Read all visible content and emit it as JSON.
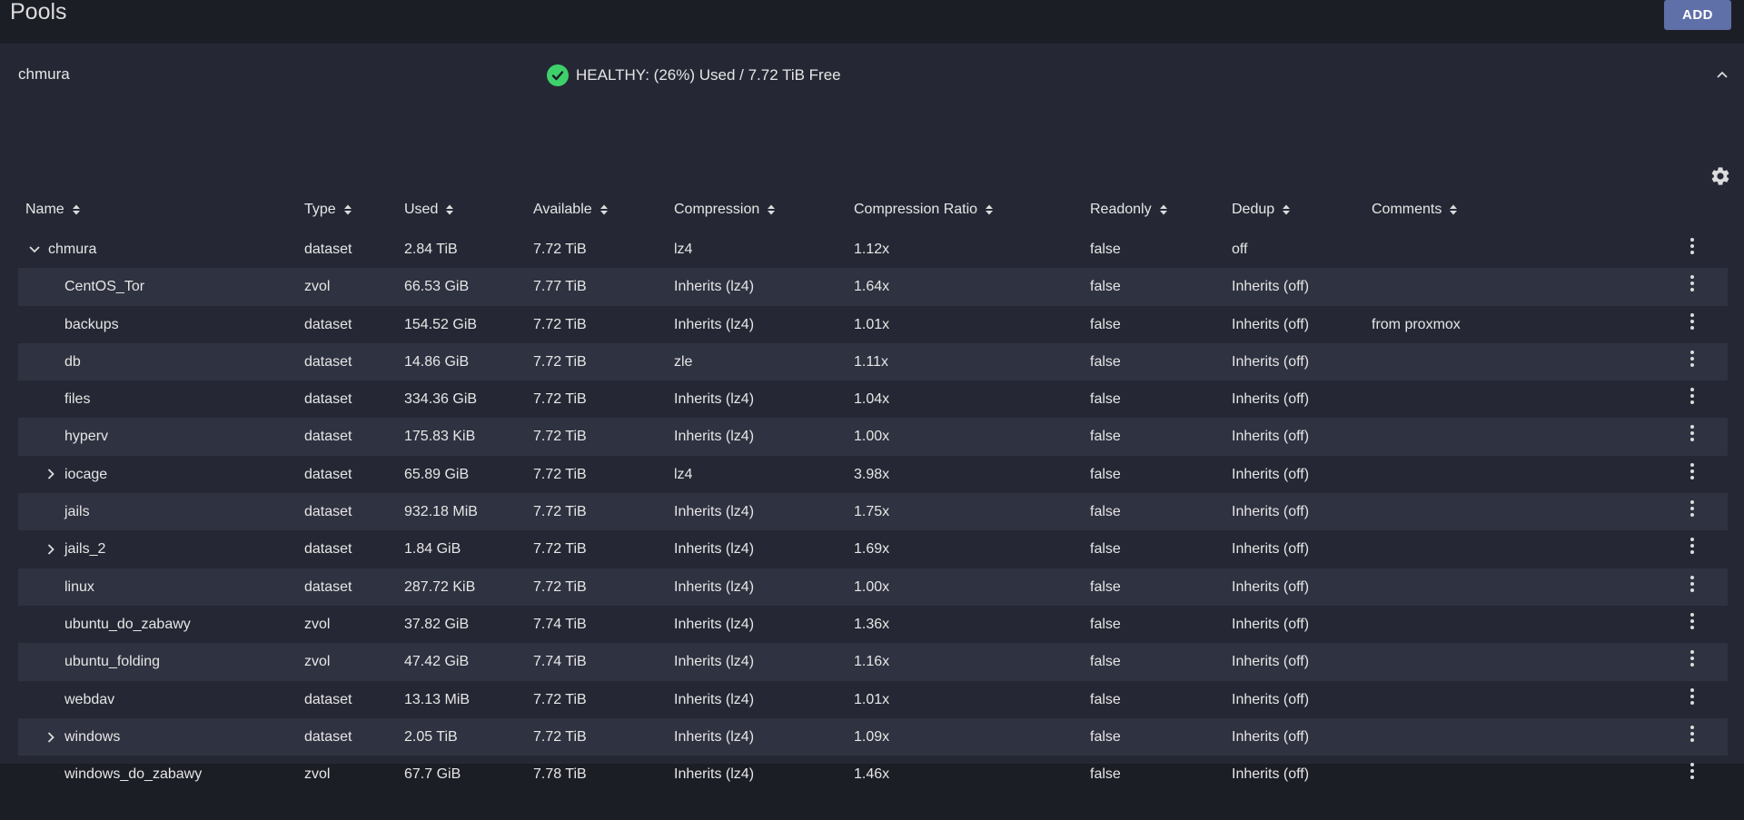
{
  "page": {
    "title": "Pools",
    "add_label": "ADD"
  },
  "pool": {
    "name": "chmura",
    "status": "HEALTHY: (26%) Used / 7.72 TiB Free",
    "status_color": "#3ed16b"
  },
  "table": {
    "columns": [
      "Name",
      "Type",
      "Used",
      "Available",
      "Compression",
      "Compression Ratio",
      "Readonly",
      "Dedup",
      "Comments"
    ],
    "rows": [
      {
        "name": "chmura",
        "type": "dataset",
        "used": "2.84 TiB",
        "available": "7.72 TiB",
        "compression": "lz4",
        "ratio": "1.12x",
        "readonly": "false",
        "dedup": "off",
        "comments": "",
        "expander": "expanded",
        "level": 0
      },
      {
        "name": "CentOS_Tor",
        "type": "zvol",
        "used": "66.53 GiB",
        "available": "7.77 TiB",
        "compression": "Inherits (lz4)",
        "ratio": "1.64x",
        "readonly": "false",
        "dedup": "Inherits (off)",
        "comments": "",
        "expander": "none",
        "level": 1
      },
      {
        "name": "backups",
        "type": "dataset",
        "used": "154.52 GiB",
        "available": "7.72 TiB",
        "compression": "Inherits (lz4)",
        "ratio": "1.01x",
        "readonly": "false",
        "dedup": "Inherits (off)",
        "comments": "from proxmox",
        "expander": "none",
        "level": 1
      },
      {
        "name": "db",
        "type": "dataset",
        "used": "14.86 GiB",
        "available": "7.72 TiB",
        "compression": "zle",
        "ratio": "1.11x",
        "readonly": "false",
        "dedup": "Inherits (off)",
        "comments": "",
        "expander": "none",
        "level": 1
      },
      {
        "name": "files",
        "type": "dataset",
        "used": "334.36 GiB",
        "available": "7.72 TiB",
        "compression": "Inherits (lz4)",
        "ratio": "1.04x",
        "readonly": "false",
        "dedup": "Inherits (off)",
        "comments": "",
        "expander": "none",
        "level": 1
      },
      {
        "name": "hyperv",
        "type": "dataset",
        "used": "175.83 KiB",
        "available": "7.72 TiB",
        "compression": "Inherits (lz4)",
        "ratio": "1.00x",
        "readonly": "false",
        "dedup": "Inherits (off)",
        "comments": "",
        "expander": "none",
        "level": 1
      },
      {
        "name": "iocage",
        "type": "dataset",
        "used": "65.89 GiB",
        "available": "7.72 TiB",
        "compression": "lz4",
        "ratio": "3.98x",
        "readonly": "false",
        "dedup": "Inherits (off)",
        "comments": "",
        "expander": "collapsed",
        "level": 1
      },
      {
        "name": "jails",
        "type": "dataset",
        "used": "932.18 MiB",
        "available": "7.72 TiB",
        "compression": "Inherits (lz4)",
        "ratio": "1.75x",
        "readonly": "false",
        "dedup": "Inherits (off)",
        "comments": "",
        "expander": "none",
        "level": 1
      },
      {
        "name": "jails_2",
        "type": "dataset",
        "used": "1.84 GiB",
        "available": "7.72 TiB",
        "compression": "Inherits (lz4)",
        "ratio": "1.69x",
        "readonly": "false",
        "dedup": "Inherits (off)",
        "comments": "",
        "expander": "collapsed",
        "level": 1
      },
      {
        "name": "linux",
        "type": "dataset",
        "used": "287.72 KiB",
        "available": "7.72 TiB",
        "compression": "Inherits (lz4)",
        "ratio": "1.00x",
        "readonly": "false",
        "dedup": "Inherits (off)",
        "comments": "",
        "expander": "none",
        "level": 1
      },
      {
        "name": "ubuntu_do_zabawy",
        "type": "zvol",
        "used": "37.82 GiB",
        "available": "7.74 TiB",
        "compression": "Inherits (lz4)",
        "ratio": "1.36x",
        "readonly": "false",
        "dedup": "Inherits (off)",
        "comments": "",
        "expander": "none",
        "level": 1
      },
      {
        "name": "ubuntu_folding",
        "type": "zvol",
        "used": "47.42 GiB",
        "available": "7.74 TiB",
        "compression": "Inherits (lz4)",
        "ratio": "1.16x",
        "readonly": "false",
        "dedup": "Inherits (off)",
        "comments": "",
        "expander": "none",
        "level": 1
      },
      {
        "name": "webdav",
        "type": "dataset",
        "used": "13.13 MiB",
        "available": "7.72 TiB",
        "compression": "Inherits (lz4)",
        "ratio": "1.01x",
        "readonly": "false",
        "dedup": "Inherits (off)",
        "comments": "",
        "expander": "none",
        "level": 1
      },
      {
        "name": "windows",
        "type": "dataset",
        "used": "2.05 TiB",
        "available": "7.72 TiB",
        "compression": "Inherits (lz4)",
        "ratio": "1.09x",
        "readonly": "false",
        "dedup": "Inherits (off)",
        "comments": "",
        "expander": "collapsed",
        "level": 1
      },
      {
        "name": "windows_do_zabawy",
        "type": "zvol",
        "used": "67.7 GiB",
        "available": "7.78 TiB",
        "compression": "Inherits (lz4)",
        "ratio": "1.46x",
        "readonly": "false",
        "dedup": "Inherits (off)",
        "comments": "",
        "expander": "none",
        "level": 1
      }
    ]
  },
  "icons": {
    "health": "check-circle-icon",
    "collapse": "chevron-up-icon",
    "settings": "gear-icon",
    "sort": "sort-icon",
    "row_actions": "more-vertical-icon"
  }
}
